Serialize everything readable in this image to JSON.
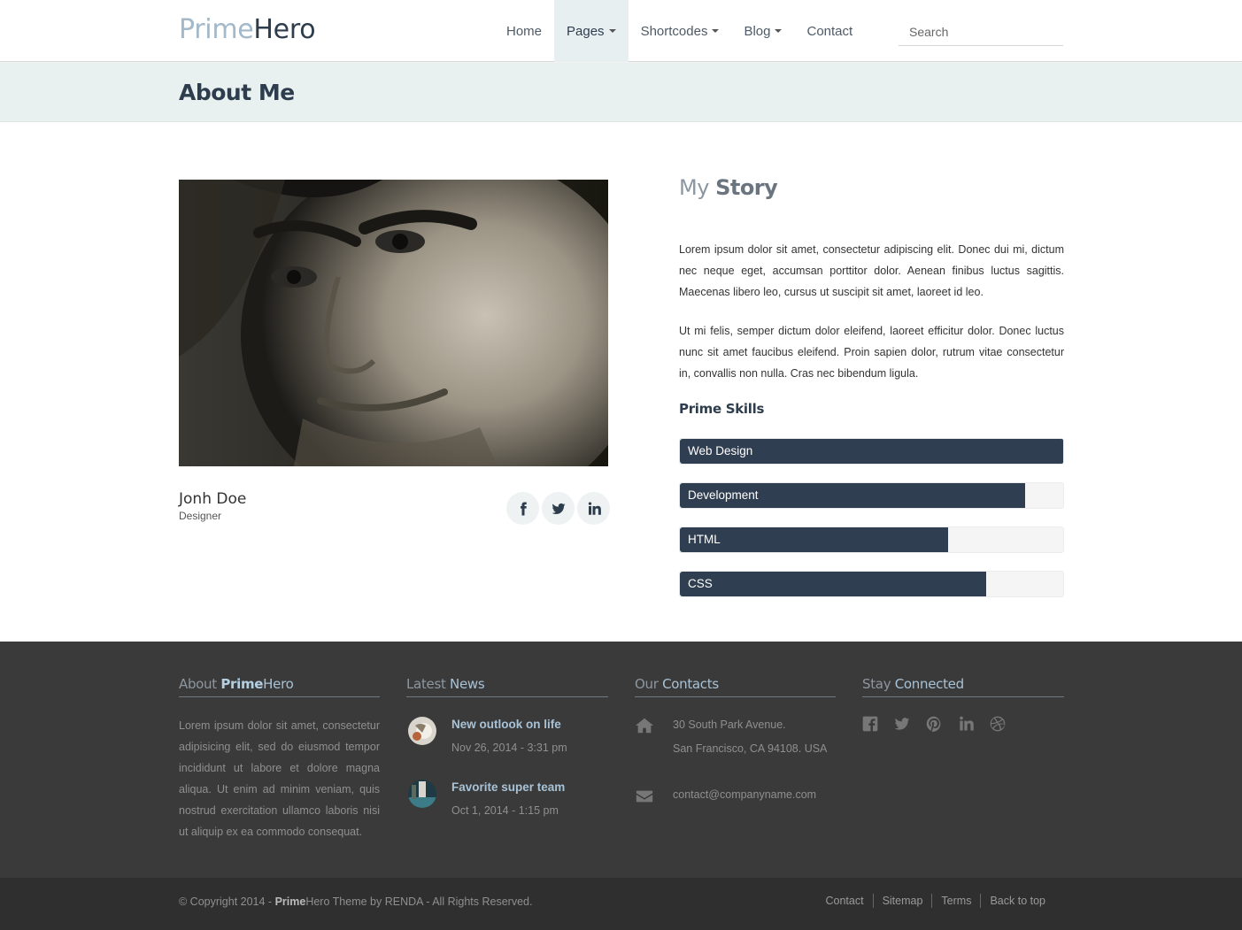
{
  "header": {
    "logo": {
      "part1": "Prime",
      "part2": "Hero"
    },
    "nav": [
      {
        "label": "Home",
        "dropdown": false,
        "active": false
      },
      {
        "label": "Pages",
        "dropdown": true,
        "active": true
      },
      {
        "label": "Shortcodes",
        "dropdown": true,
        "active": false
      },
      {
        "label": "Blog",
        "dropdown": true,
        "active": false
      },
      {
        "label": "Contact",
        "dropdown": false,
        "active": false
      }
    ],
    "search_placeholder": "Search"
  },
  "page_title": "About Me",
  "profile": {
    "name": "Jonh Doe",
    "role": "Designer",
    "social": [
      "facebook-icon",
      "twitter-icon",
      "linkedin-icon"
    ]
  },
  "story": {
    "title_light": "My",
    "title_bold": "Story",
    "paragraphs": [
      "Lorem ipsum dolor sit amet, consectetur adipiscing elit. Donec dui mi, dictum nec neque eget, accumsan porttitor dolor. Aenean finibus luctus sagittis. Maecenas libero leo, cursus ut suscipit sit amet, laoreet id leo.",
      "Ut mi felis, semper dictum dolor eleifend, laoreet efficitur dolor. Donec luctus nunc sit amet faucibus eleifend. Proin sapien dolor, rutrum vitae consectetur in, convallis non nulla. Cras nec bibendum ligula."
    ],
    "skills_title": "Prime Skills",
    "skills": [
      {
        "label": "Web Design",
        "percent": 100
      },
      {
        "label": "Development",
        "percent": 90
      },
      {
        "label": "HTML",
        "percent": 70
      },
      {
        "label": "CSS",
        "percent": 80
      }
    ]
  },
  "footer": {
    "about": {
      "heading_light": "About",
      "heading_bold": "Prime",
      "heading_brand": "Hero",
      "text": "Lorem ipsum dolor sit amet, consectetur adipisicing elit, sed do eiusmod tempor incididunt ut labore et dolore magna aliqua. Ut enim ad minim veniam, quis nostrud exercitation ullamco laboris nisi ut aliquip ex ea commodo consequat."
    },
    "news": {
      "heading_light": "Latest",
      "heading_accent": "News",
      "items": [
        {
          "title": "New outlook on life",
          "date": "Nov 26, 2014 - 3:31 pm"
        },
        {
          "title": "Favorite super team",
          "date": "Oct 1, 2014 - 1:15 pm"
        }
      ]
    },
    "contacts": {
      "heading_light": "Our",
      "heading_accent": "Contacts",
      "address_line1": "30 South Park Avenue.",
      "address_line2": "San Francisco, CA 94108. USA",
      "email": "contact@companyname.com"
    },
    "connected": {
      "heading_light": "Stay",
      "heading_accent": "Connected",
      "icons": [
        "facebook-square-icon",
        "twitter-icon",
        "pinterest-icon",
        "linkedin-icon",
        "dribbble-icon"
      ]
    }
  },
  "bottom": {
    "copyright_prefix": "© Copyright 2014 - ",
    "copyright_brand_bold": "Prime",
    "copyright_brand": "Hero",
    "copyright_suffix": " Theme by RENDA - All Rights Reserved.",
    "links": [
      "Contact",
      "Sitemap",
      "Terms",
      "Back to top"
    ]
  }
}
